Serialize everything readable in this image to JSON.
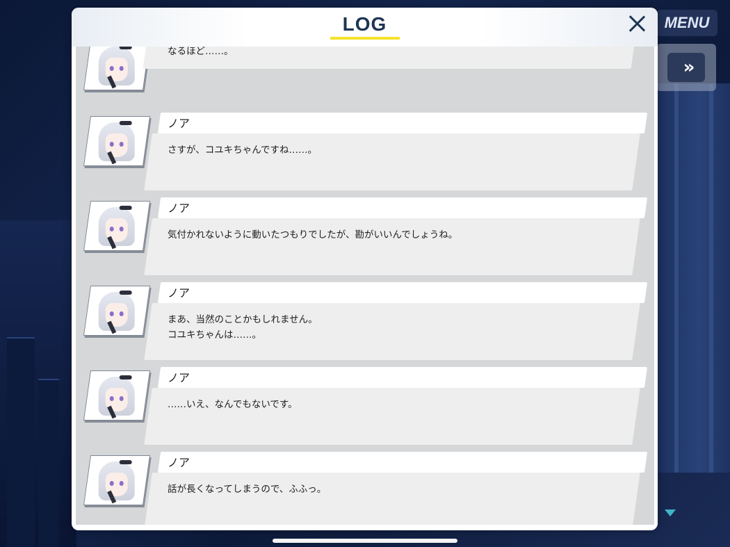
{
  "header": {
    "title": "LOG",
    "menu_label": "MENU",
    "fast_forward_glyph": "»",
    "close_icon": "close-icon"
  },
  "log": {
    "first_partial_message": "なるほど……。",
    "entries": [
      {
        "name": "ノア",
        "lines": [
          "さすが、コユキちゃんですね……。"
        ]
      },
      {
        "name": "ノア",
        "lines": [
          "気付かれないように動いたつもりでしたが、勘がいいんでしょうね。"
        ]
      },
      {
        "name": "ノア",
        "lines": [
          "まあ、当然のことかもしれません。",
          "コユキちゃんは……。"
        ]
      },
      {
        "name": "ノア",
        "lines": [
          "……いえ、なんでもないです。"
        ]
      },
      {
        "name": "ノア",
        "lines": [
          "話が長くなってしまうので、ふふっ。"
        ]
      }
    ]
  },
  "colors": {
    "title": "#1e3552",
    "underline": "#f5e32b",
    "scroll_arrow": "#3fb4c8"
  }
}
